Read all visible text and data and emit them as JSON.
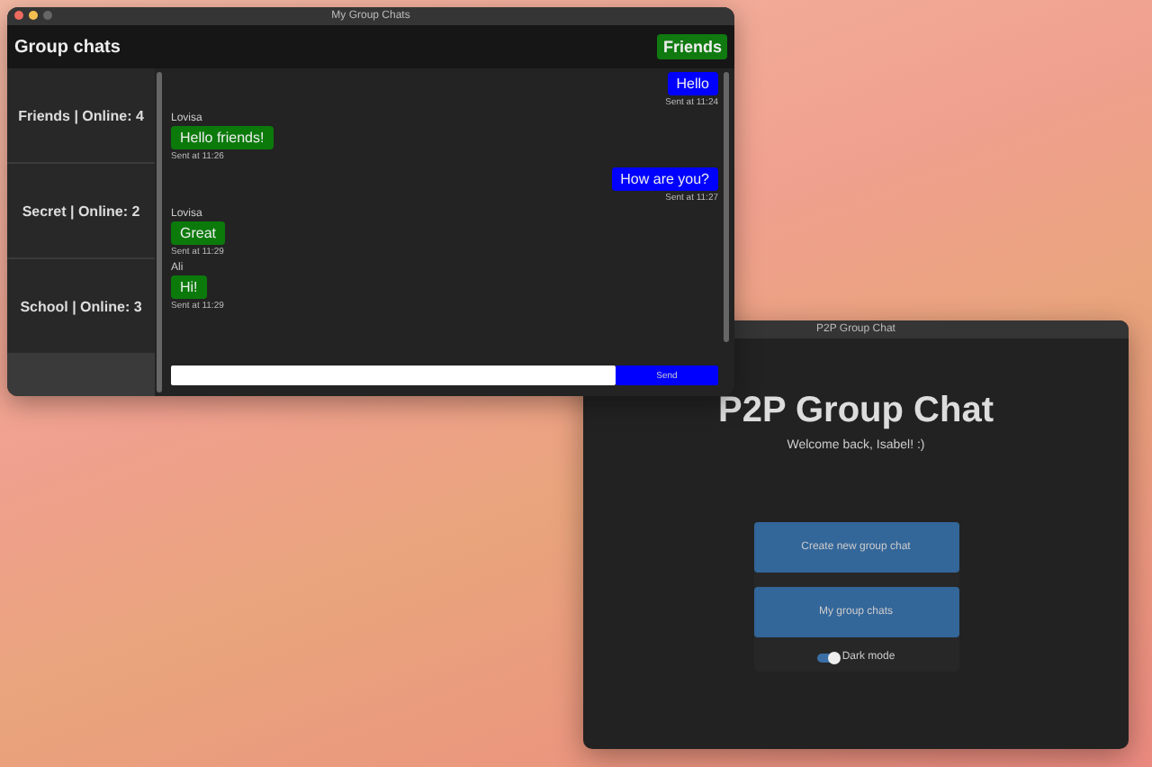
{
  "chat_window": {
    "title": "My Group Chats",
    "header": "Group chats",
    "current_chat": "Friends",
    "sidebar": {
      "items": [
        {
          "label": "Friends | Online: 4"
        },
        {
          "label": "Secret | Online: 2"
        },
        {
          "label": "School | Online: 3"
        }
      ]
    },
    "messages": [
      {
        "kind": "sent",
        "text": "Hello",
        "time": "Sent at 11:24"
      },
      {
        "kind": "received",
        "sender": "Lovisa",
        "text": "Hello friends!",
        "time": "Sent at 11:26"
      },
      {
        "kind": "sent",
        "text": "How are you?",
        "time": "Sent at 11:27"
      },
      {
        "kind": "received",
        "sender": "Lovisa",
        "text": "Great",
        "time": "Sent at 11:29"
      },
      {
        "kind": "received",
        "sender": "Ali",
        "text": "Hi!",
        "time": "Sent at 11:29"
      }
    ],
    "send_button": "Send"
  },
  "main_window": {
    "title": "P2P Group Chat",
    "heading": "P2P Group Chat",
    "welcome": "Welcome back, Isabel! :)",
    "buttons": [
      "Create new group chat",
      "My group chats"
    ],
    "dark_mode": {
      "label": "Dark mode",
      "on": true
    }
  }
}
